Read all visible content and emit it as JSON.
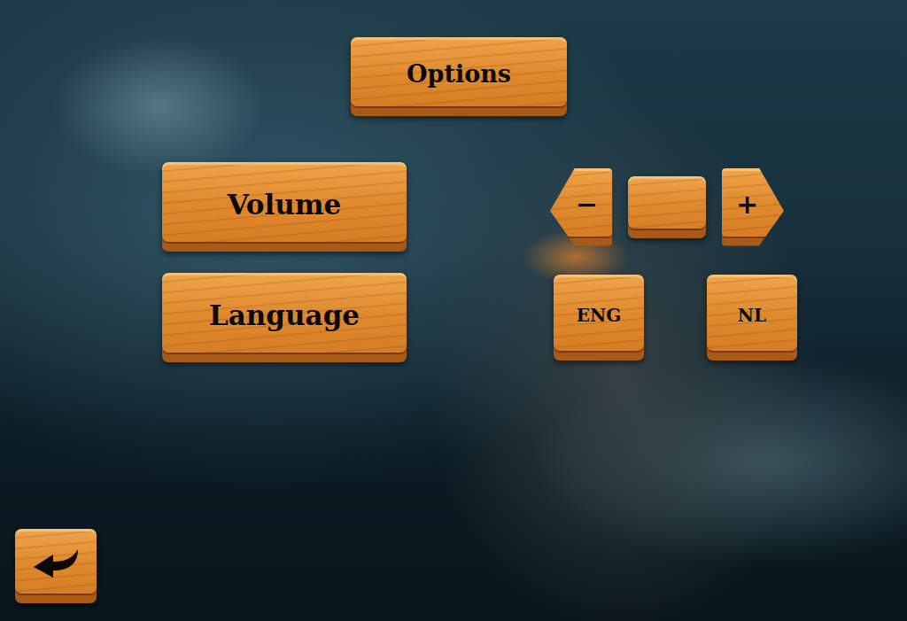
{
  "title": "Options",
  "settings": [
    {
      "label": "Volume",
      "kind": "stepper",
      "decrease": "−",
      "increase": "+"
    },
    {
      "label": "Language",
      "kind": "choice",
      "options": [
        "ENG",
        "NL"
      ]
    }
  ]
}
